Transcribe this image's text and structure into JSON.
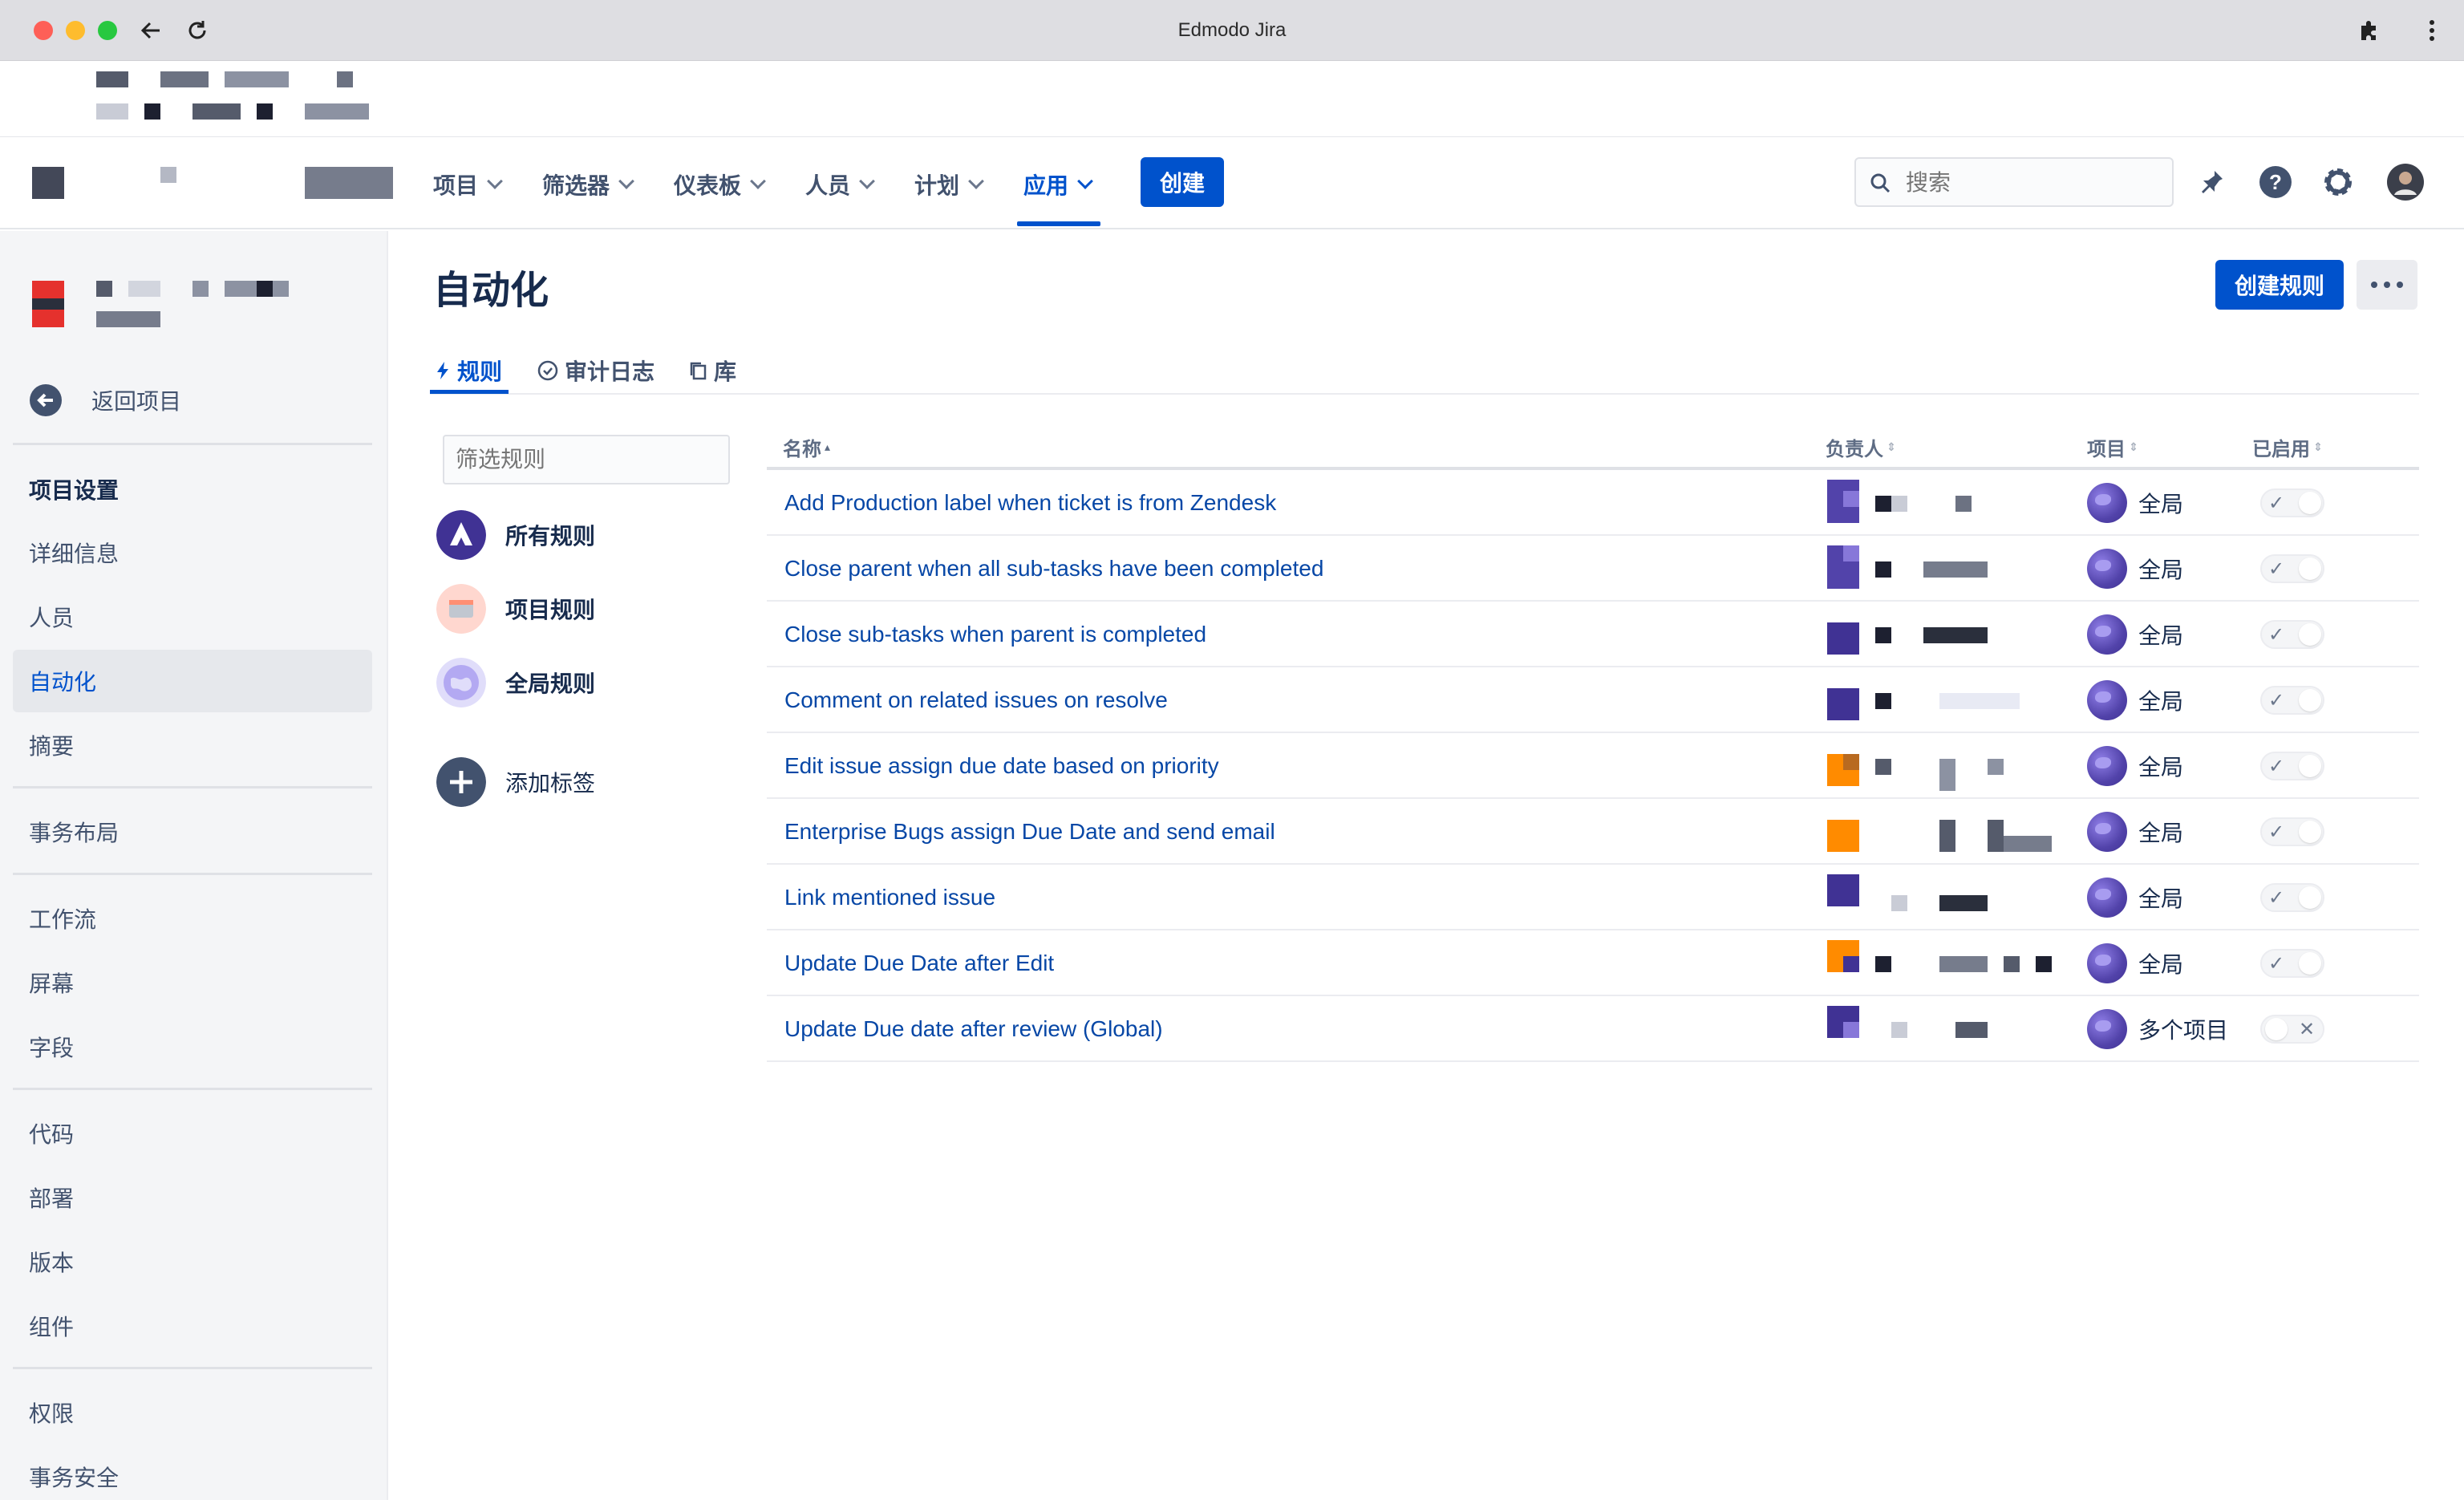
{
  "browser": {
    "title": "Edmodo Jira"
  },
  "topnav": {
    "items": [
      {
        "label": "项目"
      },
      {
        "label": "筛选器"
      },
      {
        "label": "仪表板"
      },
      {
        "label": "人员"
      },
      {
        "label": "计划"
      },
      {
        "label": "应用",
        "active": true
      }
    ],
    "create_label": "创建",
    "search_placeholder": "搜索"
  },
  "sidebar": {
    "back_label": "返回项目",
    "section_title": "项目设置",
    "items": [
      {
        "label": "详细信息"
      },
      {
        "label": "人员"
      },
      {
        "label": "自动化",
        "active": true
      },
      {
        "label": "摘要"
      },
      {
        "label": "事务布局"
      },
      {
        "label": "工作流"
      },
      {
        "label": "屏幕"
      },
      {
        "label": "字段"
      },
      {
        "label": "代码"
      },
      {
        "label": "部署"
      },
      {
        "label": "版本"
      },
      {
        "label": "组件"
      },
      {
        "label": "权限"
      },
      {
        "label": "事务安全"
      }
    ]
  },
  "main": {
    "title": "自动化",
    "create_rule_label": "创建规则",
    "tabs": [
      {
        "label": "规则",
        "active": true
      },
      {
        "label": "审计日志"
      },
      {
        "label": "库"
      }
    ],
    "filter_placeholder": "筛选规则",
    "categories": [
      {
        "label": "所有规则"
      },
      {
        "label": "项目规则"
      },
      {
        "label": "全局规则"
      },
      {
        "label": "添加标签"
      }
    ]
  },
  "table": {
    "headers": {
      "name": "名称",
      "owner": "负责人",
      "project": "项目",
      "enabled": "已启用"
    },
    "rows": [
      {
        "name": "Add Production label when ticket is from Zendesk",
        "scope": "全局",
        "enabled": true
      },
      {
        "name": "Close parent when all sub-tasks have been completed",
        "scope": "全局",
        "enabled": true
      },
      {
        "name": "Close sub-tasks when parent is completed",
        "scope": "全局",
        "enabled": true
      },
      {
        "name": "Comment on related issues on resolve",
        "scope": "全局",
        "enabled": true
      },
      {
        "name": "Edit issue assign due date based on priority",
        "scope": "全局",
        "enabled": true
      },
      {
        "name": "Enterprise Bugs assign Due Date and send email",
        "scope": "全局",
        "enabled": true
      },
      {
        "name": "Link mentioned issue",
        "scope": "全局",
        "enabled": true
      },
      {
        "name": "Update Due Date after Edit",
        "scope": "全局",
        "enabled": true
      },
      {
        "name": "Update Due date after review (Global)",
        "scope": "多个项目",
        "enabled": false
      }
    ]
  },
  "colors": {
    "brand": "#0052cc",
    "link": "#0747a6",
    "sidebar_bg": "#f4f5f7"
  }
}
